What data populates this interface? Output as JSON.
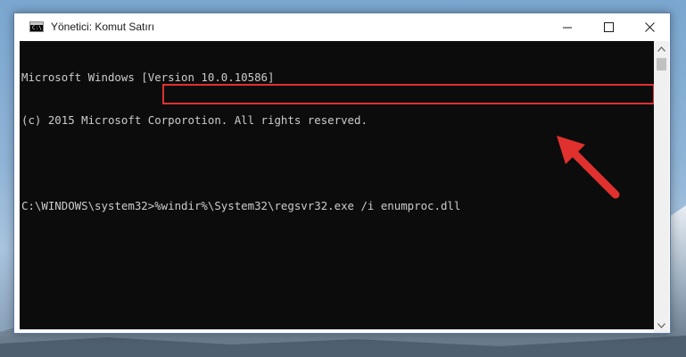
{
  "window": {
    "title": "Yönetici: Komut Satırı",
    "icon_label": "C:\\"
  },
  "titlebar_buttons": {
    "minimize": "minimize-icon",
    "maximize": "maximize-icon",
    "close": "close-icon"
  },
  "console": {
    "lines": [
      "Microsoft Windows [Version 10.0.10586]",
      "(c) 2015 Microsoft Corporotion. All rights reserved.",
      "",
      "C:\\WINDOWS\\system32>%windir%\\System32\\regsvr32.exe /i enumproc.dll"
    ]
  },
  "annotations": {
    "highlight_color": "#e0312f",
    "arrow_color": "#e0312f"
  },
  "colors": {
    "console_bg": "#0c0c0c",
    "console_text": "#cccccc"
  }
}
